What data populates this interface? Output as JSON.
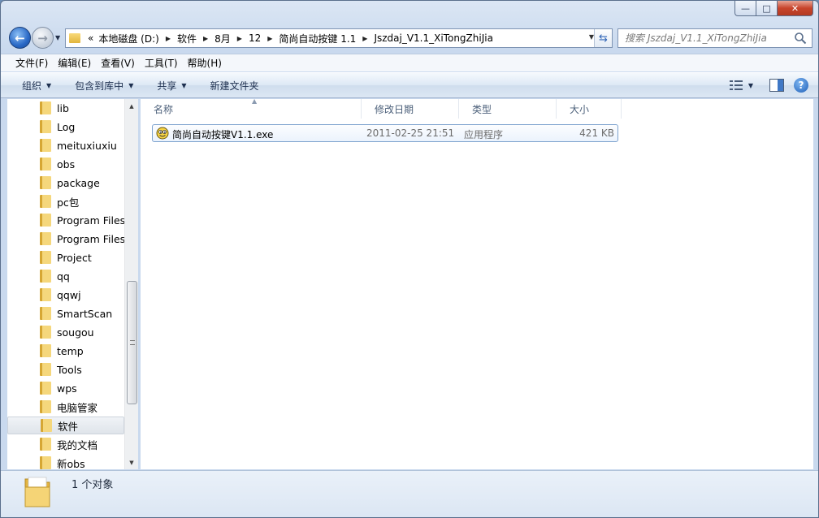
{
  "window": {
    "caption": {
      "minimize": "—",
      "maximize": "□",
      "close": "✕"
    }
  },
  "address": {
    "overflow": "«",
    "crumbs": [
      "本地磁盘 (D:)",
      "软件",
      "8月",
      "12",
      "简尚自动按键 1.1",
      "Jszdaj_V1.1_XiTongZhiJia"
    ]
  },
  "search": {
    "placeholder": "搜索 Jszdaj_V1.1_XiTongZhiJia"
  },
  "menubar": {
    "items": [
      "文件(F)",
      "编辑(E)",
      "查看(V)",
      "工具(T)",
      "帮助(H)"
    ]
  },
  "commandbar": {
    "organize": "组织",
    "include_in_library": "包含到库中",
    "share": "共享",
    "new_folder": "新建文件夹",
    "help": "?"
  },
  "navigation": {
    "items": [
      "lib",
      "Log",
      "meituxiuxiu",
      "obs",
      "package",
      "pc包",
      "Program Files",
      "Program Files",
      "Project",
      "qq",
      "qqwj",
      "SmartScan",
      "sougou",
      "temp",
      "Tools",
      "wps",
      "电脑管家",
      "软件",
      "我的文档",
      "新obs"
    ],
    "selected": "软件"
  },
  "columns": {
    "name": "名称",
    "modified": "修改日期",
    "type": "类型",
    "size": "大小"
  },
  "files": [
    {
      "name": "简尚自动按键V1.1.exe",
      "modified": "2011-02-25 21:51",
      "type": "应用程序",
      "size": "421 KB",
      "icon": "application-icon"
    }
  ],
  "status": {
    "count": "1 个对象"
  },
  "colors": {
    "accent": "#2a69c6",
    "selection": "#ebf3fd",
    "selection_border": "#7da2ce"
  }
}
